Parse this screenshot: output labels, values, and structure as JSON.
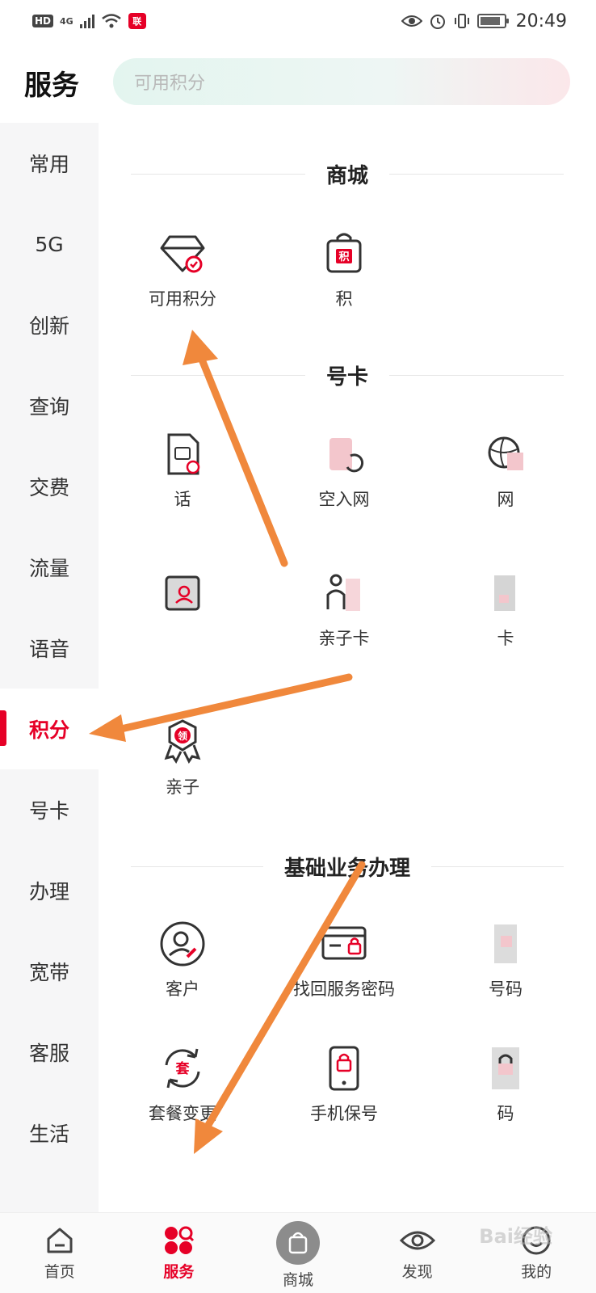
{
  "status_bar": {
    "hd": "HD",
    "network": "4G",
    "app_badge": "联",
    "time": "20:49"
  },
  "header": {
    "title": "服务",
    "search_placeholder": "可用积分"
  },
  "sidebar": {
    "items": [
      {
        "label": "常用"
      },
      {
        "label": "5G"
      },
      {
        "label": "创新"
      },
      {
        "label": "查询"
      },
      {
        "label": "交费"
      },
      {
        "label": "流量"
      },
      {
        "label": "语音"
      },
      {
        "label": "积分"
      },
      {
        "label": "号卡"
      },
      {
        "label": "办理"
      },
      {
        "label": "宽带"
      },
      {
        "label": "客服"
      },
      {
        "label": "生活"
      }
    ],
    "active": "积分"
  },
  "sections": {
    "mall": {
      "title": "商城",
      "tiles": [
        {
          "label": "可用积分",
          "icon": "diamond-icon"
        },
        {
          "label": "积",
          "icon": "points-bag-icon"
        }
      ]
    },
    "card": {
      "title": "号卡",
      "tiles": [
        {
          "label": "话",
          "icon": "sim-card-icon"
        },
        {
          "label": "空入网",
          "icon": "sim-card-icon"
        },
        {
          "label": "网",
          "icon": "globe-icon"
        },
        {
          "label": "",
          "icon": "contact-card-icon"
        },
        {
          "label": "亲子卡",
          "icon": "family-icon"
        },
        {
          "label": "卡",
          "icon": "card-icon"
        },
        {
          "label": "亲子",
          "icon": "claim-badge-icon"
        }
      ]
    },
    "basic": {
      "title": "基础业务办理",
      "tiles": [
        {
          "label": "客户",
          "icon": "user-edit-icon"
        },
        {
          "label": "找回服务密码",
          "icon": "password-card-icon"
        },
        {
          "label": "号码",
          "icon": "phone-search-icon"
        },
        {
          "label": "套餐变更",
          "icon": "plan-change-icon"
        },
        {
          "label": "手机保号",
          "icon": "phone-lock-icon"
        },
        {
          "label": "码",
          "icon": "phone-lock-icon"
        }
      ]
    }
  },
  "bottom_nav": {
    "items": [
      {
        "label": "首页",
        "icon": "home-icon"
      },
      {
        "label": "服务",
        "icon": "services-icon"
      },
      {
        "label": "商城",
        "icon": "shopping-bag-icon"
      },
      {
        "label": "发现",
        "icon": "eye-icon"
      },
      {
        "label": "我的",
        "icon": "profile-icon"
      }
    ],
    "active": "服务"
  },
  "icon_glyphs": {
    "points_bag": "积",
    "claim_badge": "领",
    "plan_change": "套"
  },
  "watermark": "Bai经验",
  "colors": {
    "accent": "#e60027",
    "annotation_arrow": "#f0883c",
    "sidebar_bg": "#f6f6f7"
  }
}
